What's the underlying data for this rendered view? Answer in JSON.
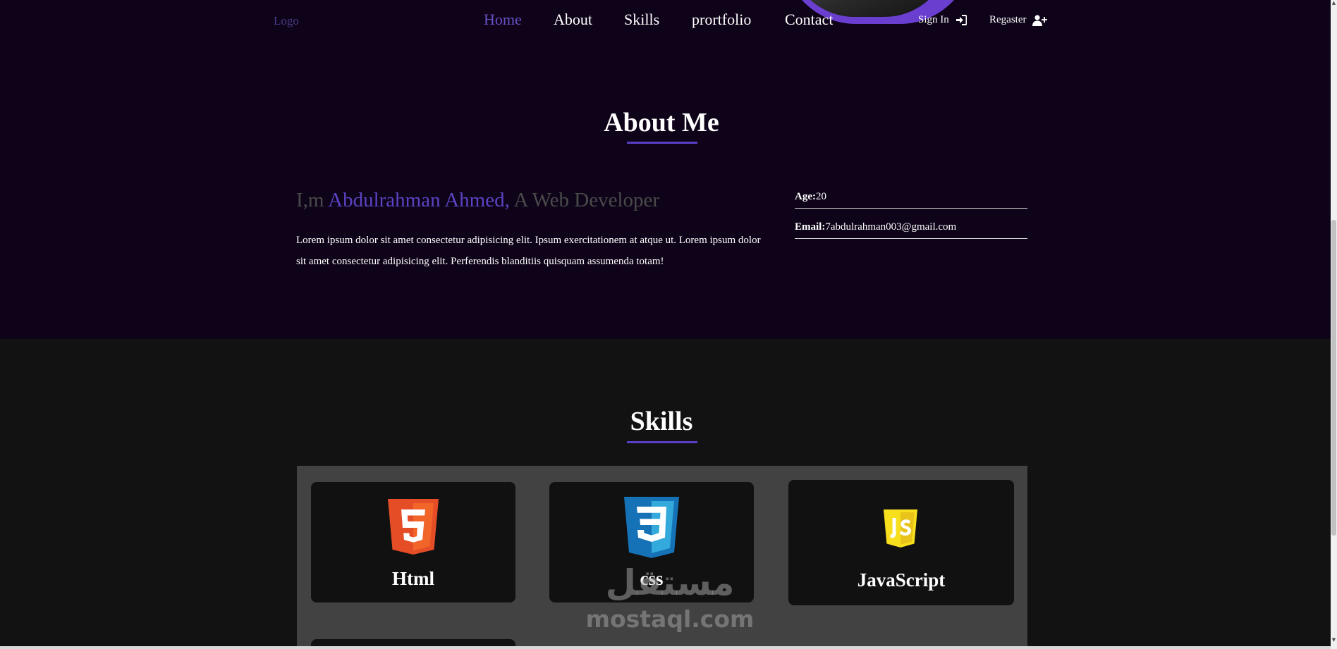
{
  "nav": {
    "logo": "Logo",
    "links": [
      {
        "label": "Home",
        "active": true
      },
      {
        "label": "About",
        "active": false
      },
      {
        "label": "Skills",
        "active": false
      },
      {
        "label": "prortfolio",
        "active": false
      },
      {
        "label": "Contact",
        "active": false
      }
    ],
    "sign_in": "Sign In",
    "register": "Regaster",
    "sign_in_icon": "sign-in-icon",
    "register_icon": "user-plus-icon"
  },
  "about": {
    "title": "About Me",
    "intro_prefix": "I,m ",
    "name": "Abdulrahman Ahmed,",
    "intro_suffix": " A Web Developer",
    "description": "Lorem ipsum dolor sit amet consectetur adipisicing elit. Ipsum exercitationem at atque ut. Lorem ipsum dolor sit amet consectetur adipisicing elit. Perferendis blanditiis quisquam assumenda totam!",
    "age_label": "Age:",
    "age_value": "20",
    "email_label": "Email:",
    "email_value": "7abdulrahman003@gmail.com"
  },
  "skills": {
    "title": "Skills",
    "items": [
      {
        "label": "Html",
        "icon": "html5-icon"
      },
      {
        "label": "css",
        "icon": "css3-icon"
      },
      {
        "label": "JavaScript",
        "icon": "javascript-icon"
      }
    ]
  },
  "watermark": {
    "arabic": "مستقل",
    "latin": "mostaql.com"
  },
  "colors": {
    "accent": "#5b3ec8",
    "about_bg": "#0e0318",
    "skills_bg": "#121212",
    "panel_bg": "#424242",
    "card_bg": "#111111"
  }
}
